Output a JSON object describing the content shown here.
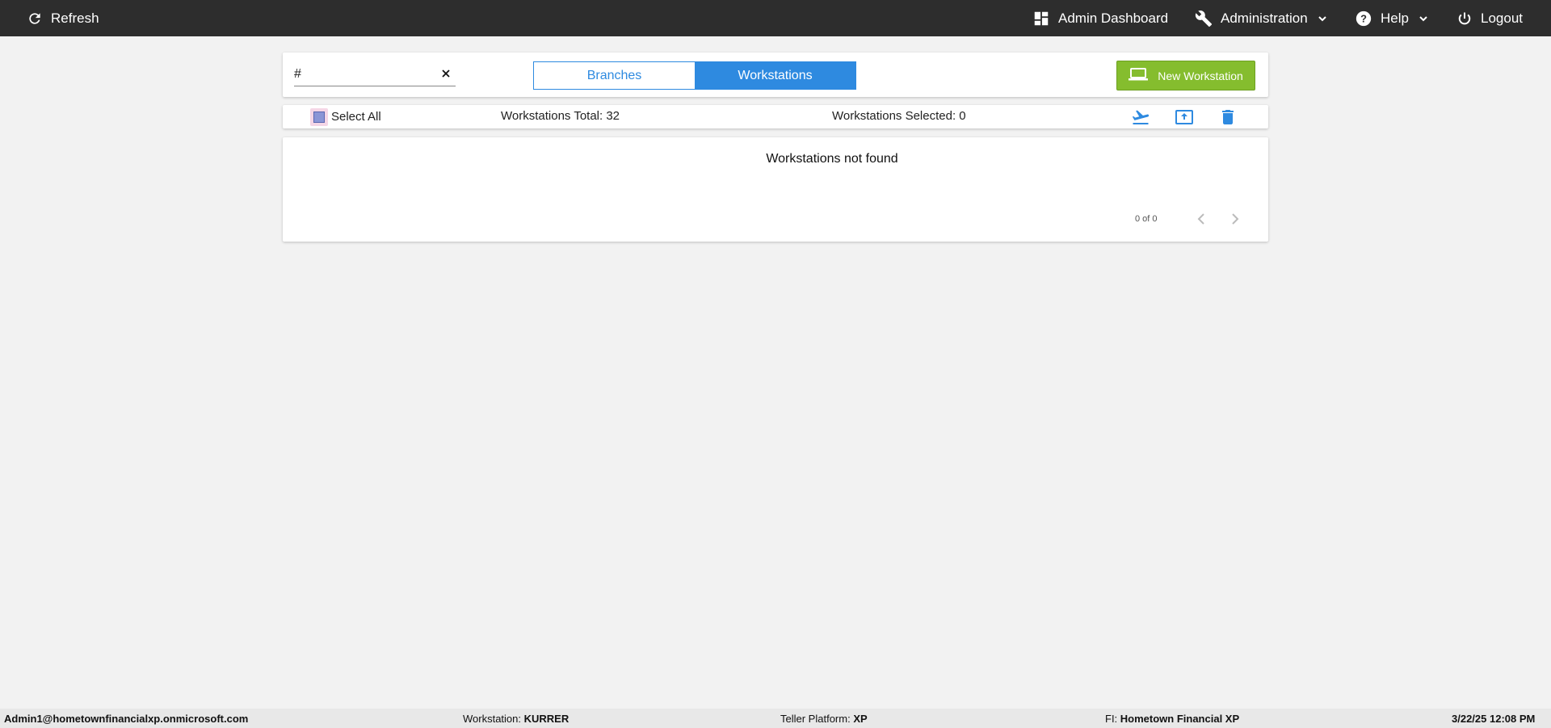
{
  "topbar": {
    "refresh_label": "Refresh",
    "dashboard_label": "Admin Dashboard",
    "administration_label": "Administration",
    "help_label": "Help",
    "logout_label": "Logout"
  },
  "search": {
    "value": "#"
  },
  "tabs": [
    {
      "label": "Branches",
      "active": false
    },
    {
      "label": "Workstations",
      "active": true
    }
  ],
  "new_button_label": "New Workstation",
  "selection": {
    "select_all_label": "Select All",
    "total_text": "Workstations Total: 32",
    "selected_text": "Workstations Selected: 0"
  },
  "results": {
    "empty_message": "Workstations not found",
    "pager_text": "0 of 0"
  },
  "footer": {
    "user": "Admin1@hometownfinancialxp.onmicrosoft.com",
    "workstation_label": "Workstation: ",
    "workstation_value": "KURRER",
    "platform_label": "Teller Platform: ",
    "platform_value": "XP",
    "fi_label": "FI: ",
    "fi_value": "Hometown Financial XP",
    "datetime": "3/22/25 12:08 PM"
  },
  "colors": {
    "topbar": "#2d2d2d",
    "accent_blue": "#2e8ae0",
    "new_button_green": "#85bd2e",
    "background": "#f2f2f2"
  },
  "icons": {
    "refresh": "refresh-icon",
    "dashboard": "dashboard-icon",
    "administration": "wrench-icon",
    "help": "help-circle-icon",
    "logout": "power-icon",
    "new_workstation": "laptop-icon",
    "actions": [
      "airplane-departure-icon",
      "upload-box-icon",
      "trash-icon"
    ]
  }
}
